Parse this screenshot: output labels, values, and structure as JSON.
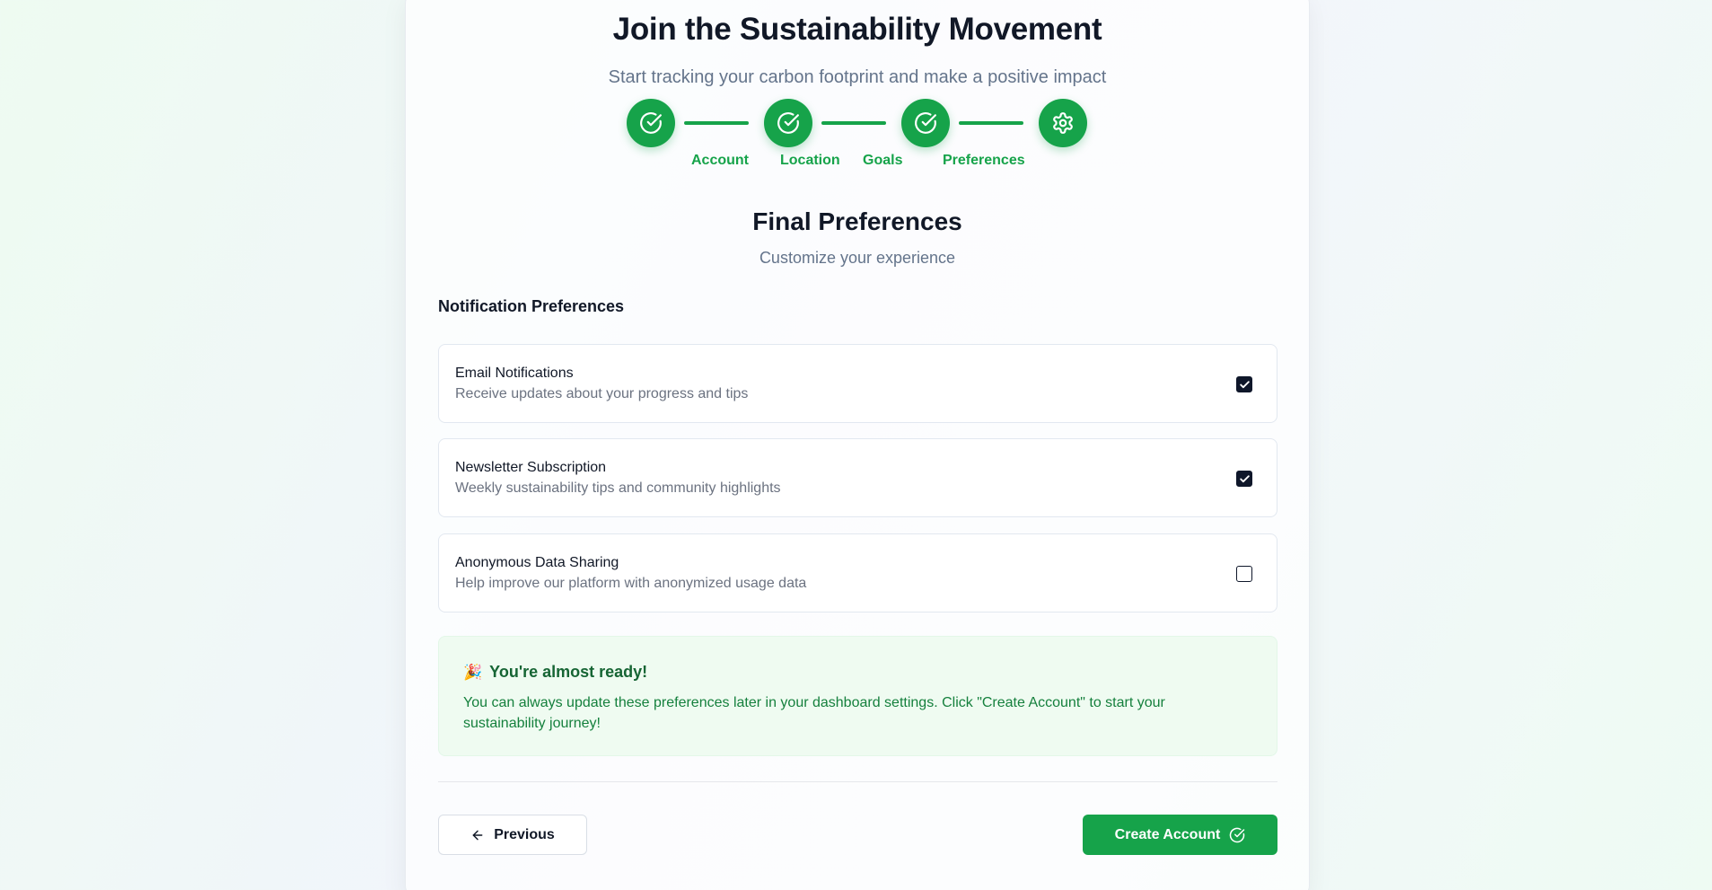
{
  "header": {
    "title": "Join the Sustainability Movement",
    "subtitle": "Start tracking your carbon footprint and make a positive impact"
  },
  "stepper": {
    "steps": [
      {
        "label": "Account",
        "icon": "check-circle-icon",
        "status": "complete"
      },
      {
        "label": "Location",
        "icon": "check-circle-icon",
        "status": "complete"
      },
      {
        "label": "Goals",
        "icon": "check-circle-icon",
        "status": "complete"
      },
      {
        "label": "Preferences",
        "icon": "gear-icon",
        "status": "current"
      }
    ],
    "accent_color": "#16a34a"
  },
  "section": {
    "title": "Final Preferences",
    "subtitle": "Customize your experience",
    "group_title": "Notification Preferences"
  },
  "preferences": [
    {
      "title": "Email Notifications",
      "description": "Receive updates about your progress and tips",
      "checked": true
    },
    {
      "title": "Newsletter Subscription",
      "description": "Weekly sustainability tips and community highlights",
      "checked": true
    },
    {
      "title": "Anonymous Data Sharing",
      "description": "Help improve our platform with anonymized usage data",
      "checked": false
    }
  ],
  "notice": {
    "emoji": "🎉",
    "title": "You're almost ready!",
    "body": "You can always update these preferences later in your dashboard settings. Click \"Create Account\" to start your sustainability journey!",
    "background_color": "#effbf1",
    "text_color": "#15803d"
  },
  "footer": {
    "previous_label": "Previous",
    "previous_icon": "arrow-left-icon",
    "create_label": "Create Account",
    "create_icon": "check-circle-icon"
  }
}
